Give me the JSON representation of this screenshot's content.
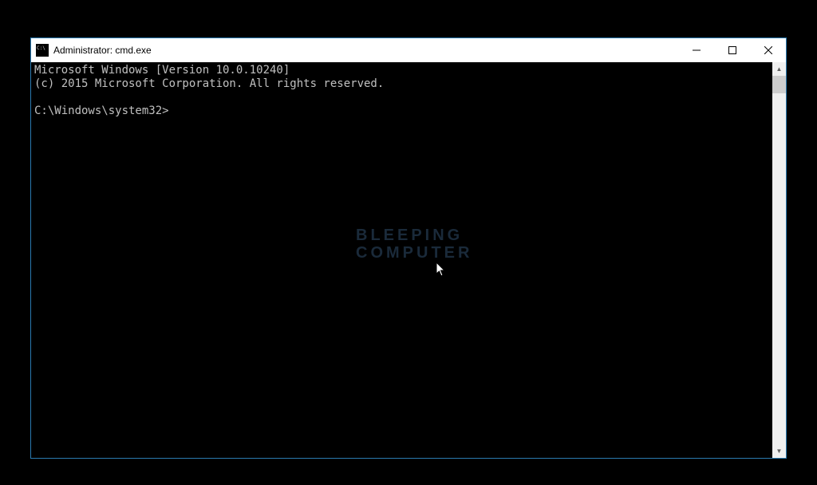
{
  "titlebar": {
    "title": "Administrator: cmd.exe"
  },
  "terminal": {
    "line1": "Microsoft Windows [Version 10.0.10240]",
    "line2": "(c) 2015 Microsoft Corporation. All rights reserved.",
    "blank": "",
    "prompt": "C:\\Windows\\system32>"
  },
  "watermark": {
    "line1": "BLEEPING",
    "line2": "COMPUTER"
  }
}
